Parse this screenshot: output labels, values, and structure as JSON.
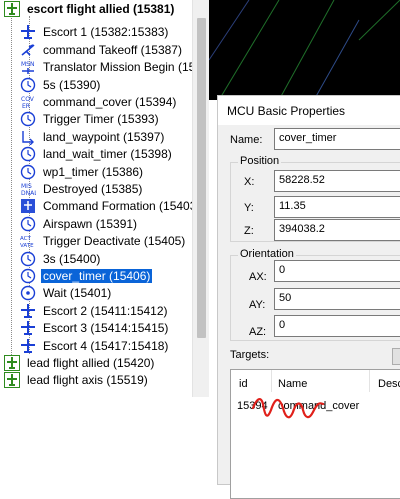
{
  "tree": {
    "items": [
      {
        "label": "escort flight allied (15381)",
        "icon": "plane-group-icon",
        "bold": true
      },
      {
        "label": "Escort 1 (15382:15383)",
        "icon": "plane-icon"
      },
      {
        "label": "command Takeoff (15387)",
        "icon": "takeoff-icon"
      },
      {
        "label": "Translator Mission Begin (15",
        "icon": "mission-begin-icon"
      },
      {
        "label": "5s (15390)",
        "icon": "timer-icon"
      },
      {
        "label": "command_cover (15394)",
        "icon": "cover-icon"
      },
      {
        "label": "Trigger Timer (15393)",
        "icon": "timer-icon"
      },
      {
        "label": "land_waypoint (15397)",
        "icon": "waypoint-icon"
      },
      {
        "label": "land_wait_timer (15398)",
        "icon": "timer-icon"
      },
      {
        "label": "wp1_timer (15386)",
        "icon": "timer-icon"
      },
      {
        "label": "Destroyed (15385)",
        "icon": "destroyed-icon"
      },
      {
        "label": "Command Formation (15403",
        "icon": "formation-icon"
      },
      {
        "label": "Airspawn (15391)",
        "icon": "timer-icon"
      },
      {
        "label": "Trigger Deactivate (15405)",
        "icon": "deactivate-icon"
      },
      {
        "label": "3s (15400)",
        "icon": "timer-icon"
      },
      {
        "label": "cover_timer (15406)",
        "icon": "timer-icon",
        "selected": true
      },
      {
        "label": "Wait (15401)",
        "icon": "wait-icon"
      },
      {
        "label": "Escort 2 (15411:15412)",
        "icon": "plane-icon"
      },
      {
        "label": "Escort 3 (15414:15415)",
        "icon": "plane-icon"
      },
      {
        "label": "Escort 4 (15417:15418)",
        "icon": "plane-icon"
      },
      {
        "label": "lead flight allied (15420)",
        "icon": "plane-group-icon"
      },
      {
        "label": "lead flight axis (15519)",
        "icon": "plane-group-icon"
      }
    ]
  },
  "dialog": {
    "title": "MCU Basic Properties",
    "name_label": "Name:",
    "name_value": "cover_timer",
    "position_label": "Position",
    "x_label": "X:",
    "x_value": "58228.52",
    "y_label": "Y:",
    "y_value": "11.35",
    "z_label": "Z:",
    "z_value": "394038.2",
    "orientation_label": "Orientation",
    "ax_label": "AX:",
    "ax_value": "0",
    "ay_label": "AY:",
    "ay_value": "50",
    "az_label": "AZ:",
    "az_value": "0",
    "targets_label": "Targets:",
    "targets_columns": [
      "id",
      "Name",
      "Desc"
    ],
    "targets_rows": [
      {
        "id": "15394",
        "name": "command_cover"
      }
    ]
  },
  "colors": {
    "selection": "#0a64d8",
    "icon_blue": "#1a3fd6",
    "icon_green": "#2e8b1e",
    "scribble": "#e0201a"
  }
}
